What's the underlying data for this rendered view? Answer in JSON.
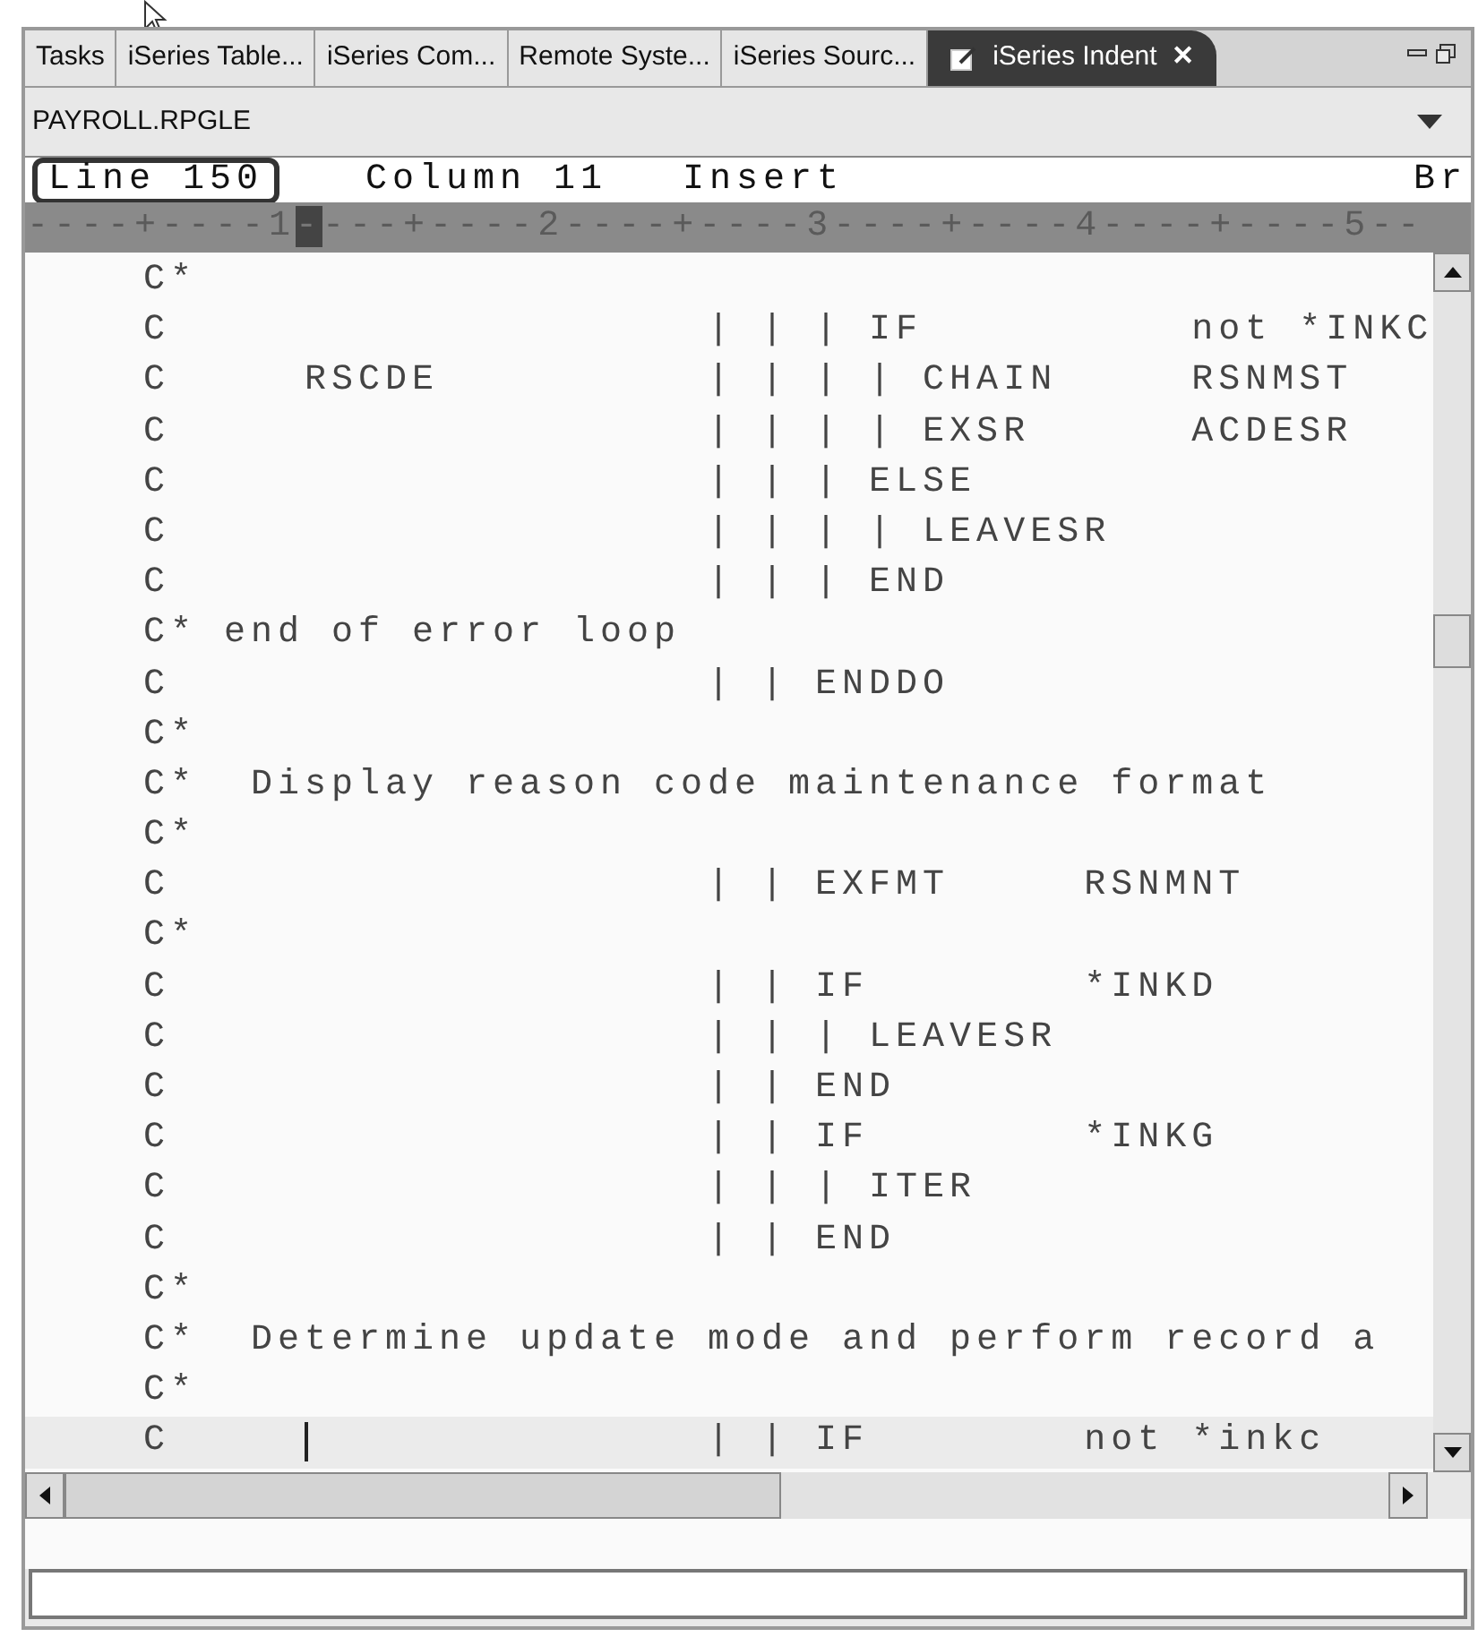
{
  "tabs": [
    {
      "label": "Tasks",
      "selected": false
    },
    {
      "label": "iSeries Table...",
      "selected": false
    },
    {
      "label": "iSeries Com...",
      "selected": false
    },
    {
      "label": "Remote Syste...",
      "selected": false
    },
    {
      "label": "iSeries Sourc...",
      "selected": false
    },
    {
      "label": "iSeries Indent",
      "selected": true,
      "close": "✕"
    }
  ],
  "file": {
    "name": "PAYROLL.RPGLE"
  },
  "status": {
    "line": "Line 150",
    "column": "Column 11",
    "mode": "Insert",
    "extra": "Br"
  },
  "ruler": {
    "before": "----+----1",
    "marker": "-",
    "after": "---+----2----+----3----+----4----+----5--"
  },
  "code": [
    {
      "text": "C*",
      "current": false
    },
    {
      "text": "C                    | | | IF          not *INKC",
      "current": false
    },
    {
      "text": "C     RSCDE          | | | | CHAIN     RSNMST",
      "current": false
    },
    {
      "text": "C                    | | | | EXSR      ACDESR",
      "current": false
    },
    {
      "text": "C                    | | | ELSE",
      "current": false
    },
    {
      "text": "C                    | | | | LEAVESR",
      "current": false
    },
    {
      "text": "C                    | | | END",
      "current": false
    },
    {
      "text": "C* end of error loop",
      "current": false
    },
    {
      "text": "C                    | | ENDDO",
      "current": false
    },
    {
      "text": "C*",
      "current": false
    },
    {
      "text": "C*  Display reason code maintenance format",
      "current": false
    },
    {
      "text": "C*",
      "current": false
    },
    {
      "text": "C                    | | EXFMT     RSNMNT",
      "current": false
    },
    {
      "text": "C*",
      "current": false
    },
    {
      "text": "C                    | | IF        *INKD",
      "current": false
    },
    {
      "text": "C                    | | | LEAVESR",
      "current": false
    },
    {
      "text": "C                    | | END",
      "current": false
    },
    {
      "text": "C                    | | IF        *INKG",
      "current": false
    },
    {
      "text": "C                    | | | ITER",
      "current": false
    },
    {
      "text": "C                    | | END",
      "current": false
    },
    {
      "text": "C*",
      "current": false
    },
    {
      "text": "C*  Determine update mode and perform record a",
      "current": false
    },
    {
      "text": "C*",
      "current": false
    },
    {
      "text": "C                    | | IF        not *inkc",
      "current": true
    }
  ]
}
